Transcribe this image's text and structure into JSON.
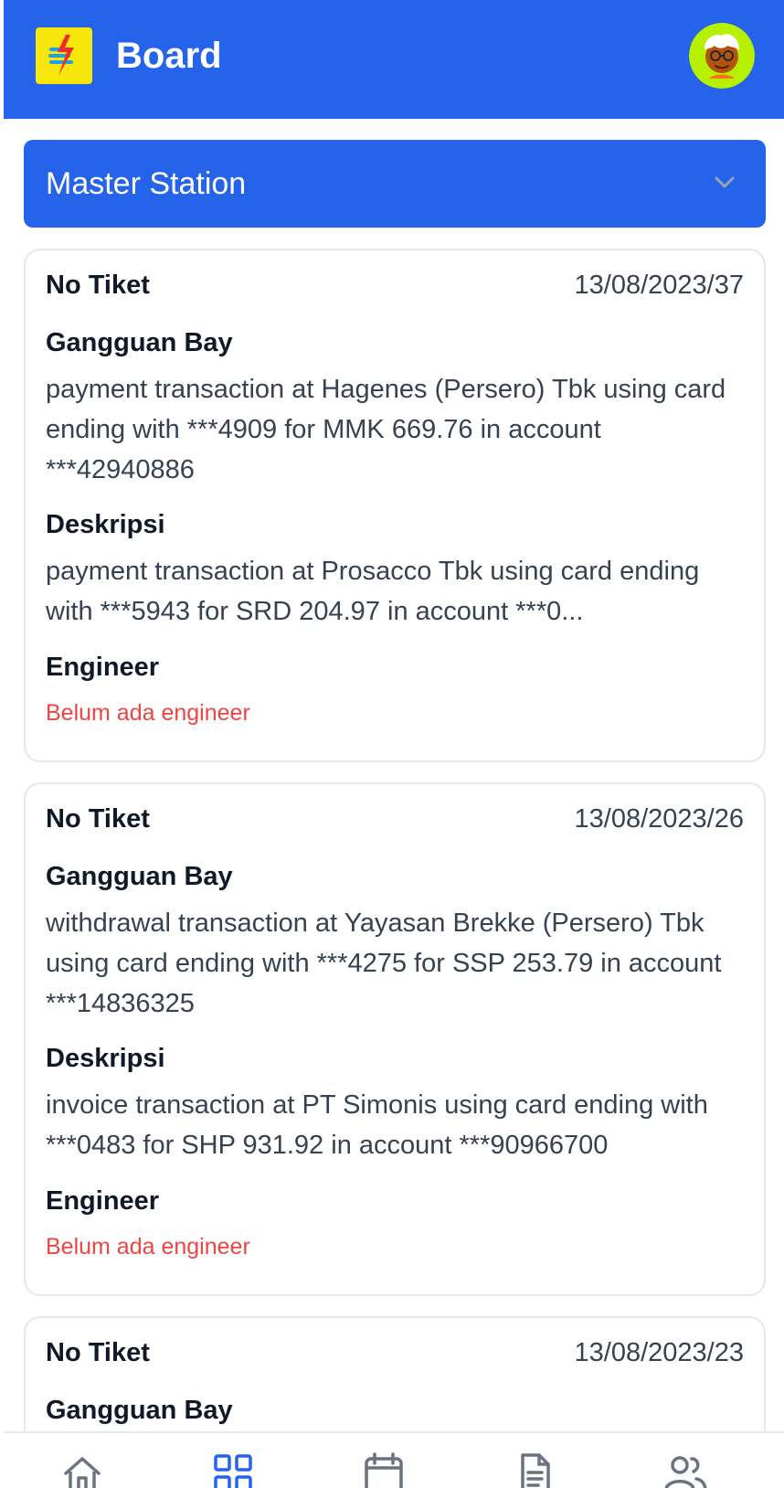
{
  "header": {
    "title": "Board",
    "brand_color": "#2563eb",
    "logo_icon": "lightning-logo-icon",
    "avatar_icon": "user-avatar"
  },
  "station_selector": {
    "selected": "Master Station"
  },
  "tickets": [
    {
      "ticket_label": "No Tiket",
      "ticket_number": "13/08/2023/37",
      "bay_label": "Gangguan Bay",
      "bay_text": "payment transaction at Hagenes (Persero) Tbk using card ending with ***4909 for MMK 669.76 in account ***42940886",
      "description_label": "Deskripsi",
      "description_text": "payment transaction at Prosacco Tbk using card ending with ***5943 for SRD 204.97 in account ***0...",
      "engineer_label": "Engineer",
      "engineer_value": "Belum ada engineer"
    },
    {
      "ticket_label": "No Tiket",
      "ticket_number": "13/08/2023/26",
      "bay_label": "Gangguan Bay",
      "bay_text": "withdrawal transaction at Yayasan Brekke (Persero) Tbk using card ending with ***4275 for SSP 253.79 in account ***14836325",
      "description_label": "Deskripsi",
      "description_text": "invoice transaction at PT Simonis using card ending with ***0483 for SHP 931.92 in account ***90966700",
      "engineer_label": "Engineer",
      "engineer_value": "Belum ada engineer"
    },
    {
      "ticket_label": "No Tiket",
      "ticket_number": "13/08/2023/23",
      "bay_label": "Gangguan Bay"
    }
  ],
  "bottom_nav": {
    "items": [
      {
        "icon": "home-icon",
        "active": false
      },
      {
        "icon": "grid-icon",
        "active": true
      },
      {
        "icon": "calendar-icon",
        "active": false
      },
      {
        "icon": "document-icon",
        "active": false
      },
      {
        "icon": "users-icon",
        "active": false
      }
    ],
    "active_color": "#2563eb",
    "inactive_color": "#6b7280"
  }
}
